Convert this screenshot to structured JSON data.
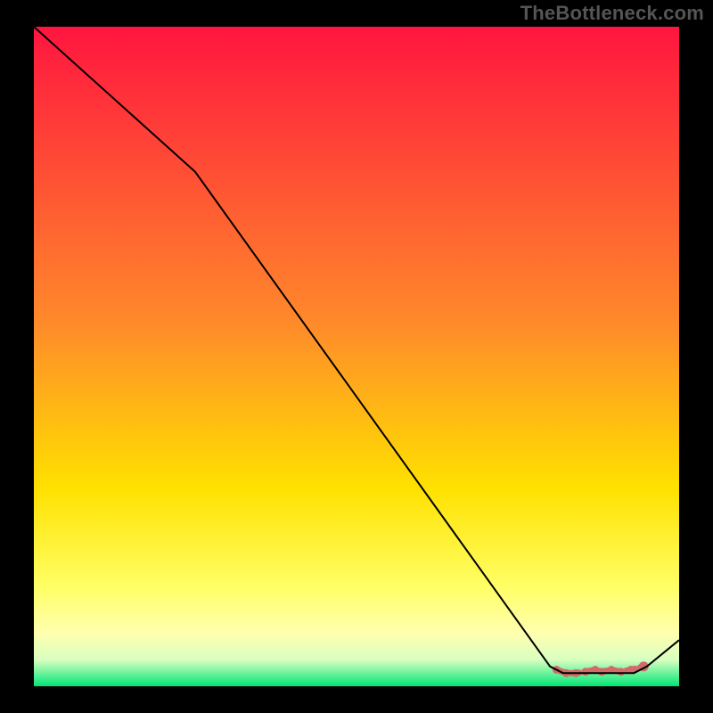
{
  "watermark": "TheBottleneck.com",
  "chart_data": {
    "type": "line",
    "title": "",
    "xlabel": "",
    "ylabel": "",
    "xlim": [
      0,
      100
    ],
    "ylim": [
      0,
      100
    ],
    "grid": false,
    "legend": false,
    "gradient_stops": [
      {
        "offset": 0,
        "color": "#ff153f"
      },
      {
        "offset": 45,
        "color": "#ff8a2a"
      },
      {
        "offset": 70,
        "color": "#ffe100"
      },
      {
        "offset": 85,
        "color": "#ffff66"
      },
      {
        "offset": 92,
        "color": "#ffffb0"
      },
      {
        "offset": 96,
        "color": "#d8ffc0"
      },
      {
        "offset": 100,
        "color": "#00e676"
      }
    ],
    "series": [
      {
        "name": "bottleneck-curve",
        "color": "#000000",
        "x": [
          0,
          25,
          80,
          82,
          93,
          95,
          100
        ],
        "y": [
          100,
          78,
          3,
          2,
          2,
          3,
          7
        ]
      }
    ],
    "markers": [
      {
        "name": "marker-band",
        "color": "#d26a6a",
        "points": [
          {
            "x": 81,
            "y": 2.5
          },
          {
            "x": 82.5,
            "y": 2.0
          },
          {
            "x": 84,
            "y": 2.0
          },
          {
            "x": 85.5,
            "y": 2.2
          },
          {
            "x": 87,
            "y": 2.5
          },
          {
            "x": 88,
            "y": 2.2
          },
          {
            "x": 89.5,
            "y": 2.5
          },
          {
            "x": 91,
            "y": 2.2
          },
          {
            "x": 92.5,
            "y": 2.5
          },
          {
            "x": 94.5,
            "y": 3.0
          }
        ]
      }
    ]
  }
}
